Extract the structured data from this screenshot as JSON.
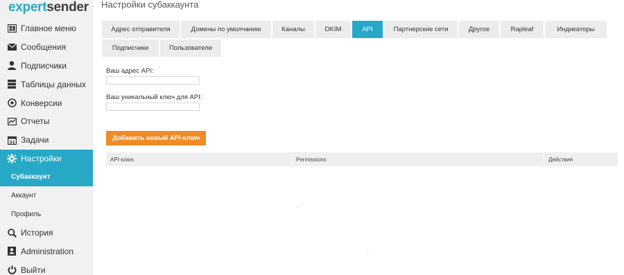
{
  "logo": {
    "part1": "expert",
    "part2": "sender"
  },
  "sidebar": {
    "items": [
      {
        "label": "Главное меню",
        "icon": "home-icon"
      },
      {
        "label": "Сообщения",
        "icon": "envelope-icon"
      },
      {
        "label": "Подписчики",
        "icon": "user-icon"
      },
      {
        "label": "Таблицы данных",
        "icon": "database-icon"
      },
      {
        "label": "Конверсии",
        "icon": "target-icon"
      },
      {
        "label": "Отчеты",
        "icon": "chart-icon"
      },
      {
        "label": "Задачи",
        "icon": "calendar-icon",
        "badge": "31"
      },
      {
        "label": "Настройки",
        "icon": "gear-icon"
      },
      {
        "label": "Субаккаунт"
      },
      {
        "label": "Аккаунт"
      },
      {
        "label": "Профиль"
      },
      {
        "label": "История",
        "icon": "search-icon"
      },
      {
        "label": "Administration",
        "icon": "contacts-icon"
      },
      {
        "label": "Выйти",
        "icon": "power-icon"
      }
    ]
  },
  "page_title": "Настройки субаккаунта",
  "tabs_row1": [
    "Адрес отправителя",
    "Домены по умолчанию",
    "Каналы",
    "DKIM",
    "API",
    "Партнерские сети",
    "Другое",
    "Rapleaf",
    "Индикаторы"
  ],
  "tabs_row2": [
    "Подписчики",
    "Пользователи"
  ],
  "form": {
    "api_address_label": "Ваш адрес API:",
    "api_address_value": "",
    "api_key_label": "Ваш уникальный ключ для API:",
    "api_key_value": ""
  },
  "add_button_label": "Добавить новый API-ключ",
  "table_headers": [
    "API-ключ",
    "Permissions",
    "Действия"
  ],
  "colors": {
    "accent": "#27a8c7",
    "button": "#f08b27",
    "sidebar": "#f1f1f1"
  }
}
